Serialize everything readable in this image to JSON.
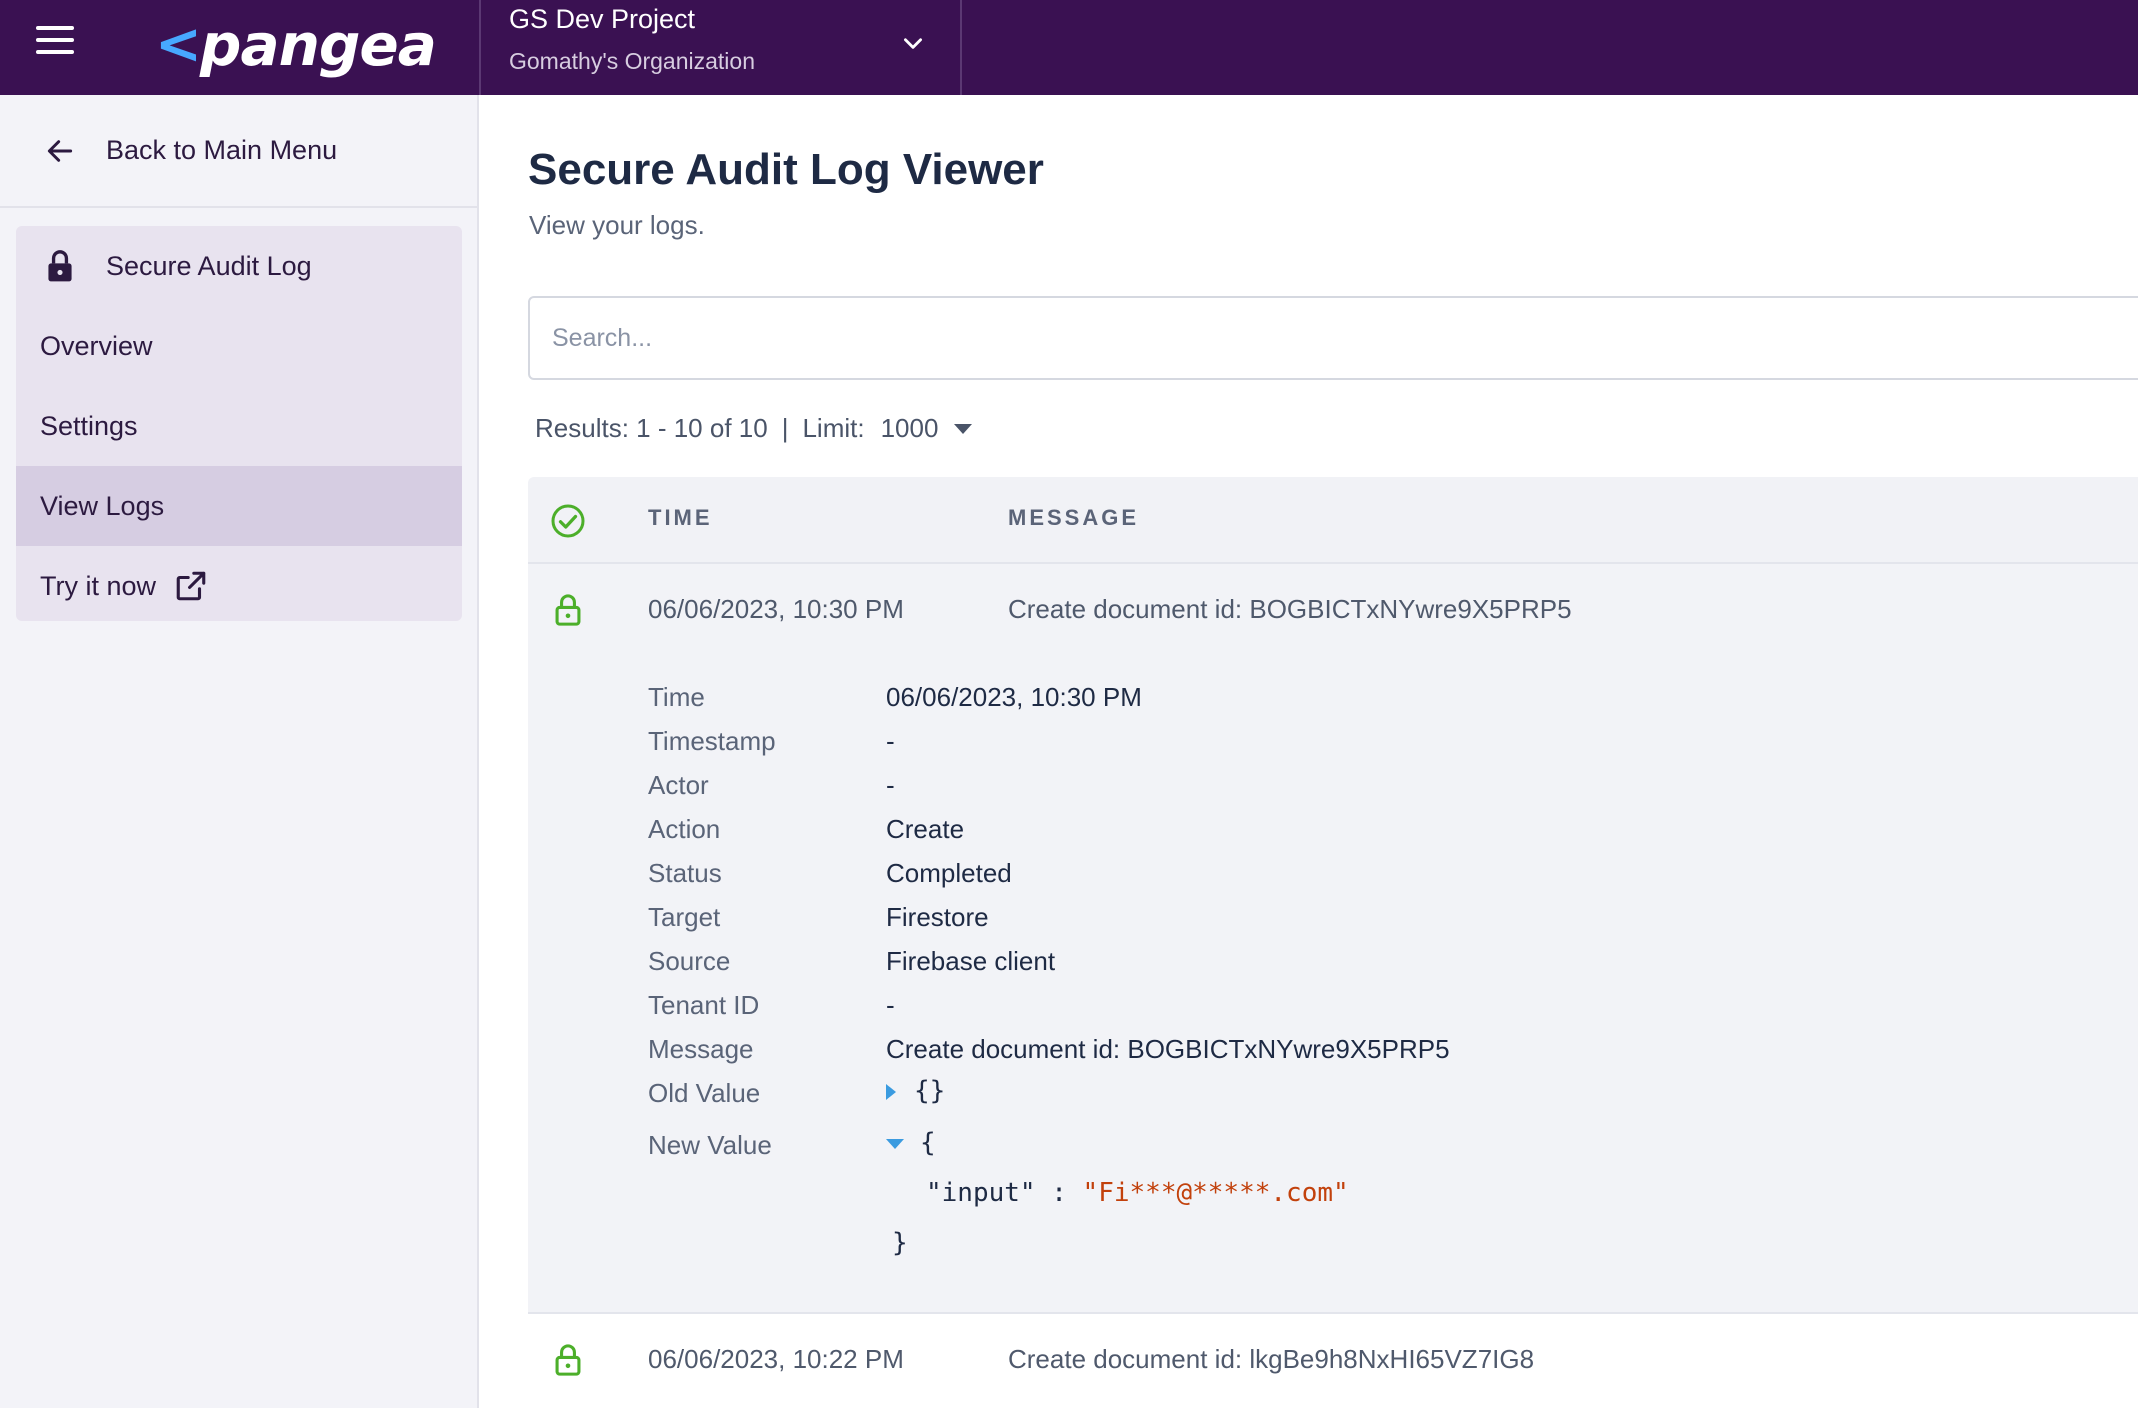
{
  "topbar": {
    "logo_chevron": "<",
    "logo_text": "pangea",
    "project_name": "GS Dev Project",
    "organization": "Gomathy's Organization"
  },
  "sidebar": {
    "back_label": "Back to Main Menu",
    "section_title": "Secure Audit Log",
    "items": [
      {
        "label": "Overview",
        "active": false
      },
      {
        "label": "Settings",
        "active": false
      },
      {
        "label": "View Logs",
        "active": true
      },
      {
        "label": "Try it now",
        "active": false
      }
    ]
  },
  "main": {
    "title": "Secure Audit Log Viewer",
    "subtitle": "View your logs.",
    "search_placeholder": "Search...",
    "results_text": "Results: 1 - 10 of 10",
    "separator": "|",
    "limit_label": "Limit:",
    "limit_value": "1000",
    "columns": {
      "time": "TIME",
      "message": "MESSAGE"
    },
    "rows": [
      {
        "time": "06/06/2023, 10:30 PM",
        "message": "Create document id: BOGBICTxNYwre9X5PRP5",
        "details": {
          "time_label": "Time",
          "time": "06/06/2023, 10:30 PM",
          "timestamp_label": "Timestamp",
          "timestamp": "-",
          "actor_label": "Actor",
          "actor": "-",
          "action_label": "Action",
          "action": "Create",
          "status_label": "Status",
          "status": "Completed",
          "target_label": "Target",
          "target": "Firestore",
          "source_label": "Source",
          "source": "Firebase client",
          "tenant_label": "Tenant ID",
          "tenant": "-",
          "message_label": "Message",
          "message": "Create document id: BOGBICTxNYwre9X5PRP5",
          "old_value_label": "Old Value",
          "old_value": "{}",
          "new_value_label": "New Value",
          "new_value_open": "{",
          "new_value_key": "\"input\"",
          "new_value_colon": ":",
          "new_value_val": "\"Fi***@*****.com\"",
          "new_value_close": "}"
        }
      },
      {
        "time": "06/06/2023, 10:22 PM",
        "message": "Create document id: lkgBe9h8NxHI65VZ7IG8"
      }
    ]
  },
  "colors": {
    "topbar": "#3a1152",
    "accent_green": "#4caf2a",
    "logo_chevron": "#47a8ff",
    "json_string": "#c2410c"
  }
}
